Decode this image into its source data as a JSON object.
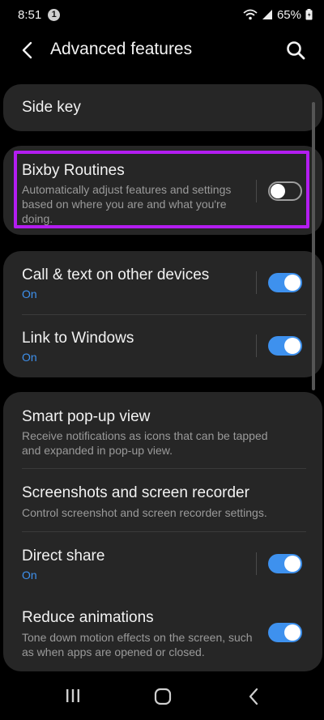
{
  "status_bar": {
    "time": "8:51",
    "notification_count": "1",
    "battery": "65%"
  },
  "app_bar": {
    "title": "Advanced features"
  },
  "cards": {
    "side_key": {
      "title": "Side key"
    },
    "bixby": {
      "title": "Bixby Routines",
      "description": "Automatically adjust features and settings based on where you are and what you're doing.",
      "enabled": false
    },
    "call_text": {
      "title": "Call & text on other devices",
      "status": "On",
      "enabled": true
    },
    "link_windows": {
      "title": "Link to Windows",
      "status": "On",
      "enabled": true
    },
    "smart_popup": {
      "title": "Smart pop-up view",
      "description": "Receive notifications as icons that can be tapped and expanded in pop-up view."
    },
    "screenshots": {
      "title": "Screenshots and screen recorder",
      "description": "Control screenshot and screen recorder settings."
    },
    "direct_share": {
      "title": "Direct share",
      "status": "On",
      "enabled": true
    },
    "reduce_anim": {
      "title": "Reduce animations",
      "description": "Tone down motion effects on the screen, such as when apps are opened or closed.",
      "enabled": true
    }
  },
  "colors": {
    "accent": "#3e91ee",
    "highlight": "#b31df0",
    "card": "#262626"
  },
  "icons": [
    "back-arrow-icon",
    "search-icon",
    "wifi-icon",
    "signal-icon",
    "battery-icon",
    "recents-icon",
    "home-icon",
    "back-icon"
  ]
}
